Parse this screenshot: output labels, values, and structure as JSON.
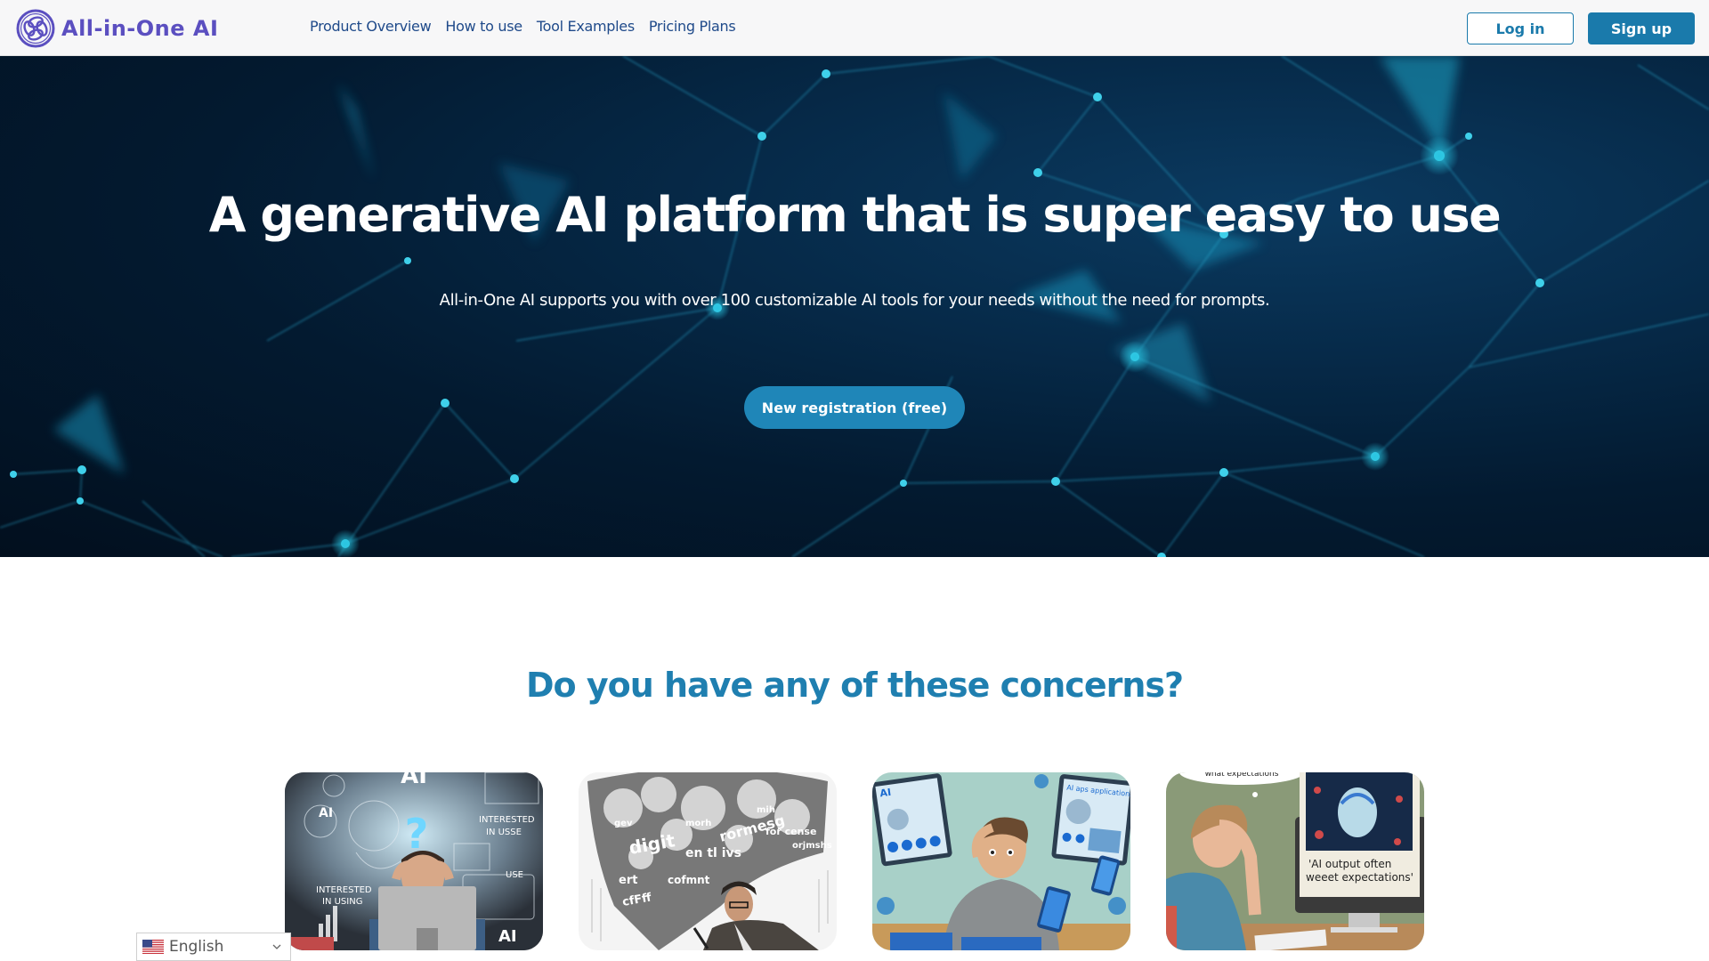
{
  "header": {
    "brand": "All-in-One AI",
    "nav": [
      {
        "label": "Product Overview"
      },
      {
        "label": "How to use"
      },
      {
        "label": "Tool Examples"
      },
      {
        "label": "Pricing Plans"
      }
    ],
    "login_label": "Log in",
    "signup_label": "Sign up"
  },
  "hero": {
    "title": "A generative AI platform that is super easy to use",
    "subtitle": "All-in-One AI supports you with over 100 customizable AI tools for your needs without the need for prompts.",
    "cta_label": "New registration (free)"
  },
  "concerns": {
    "title": "Do you have any of these concerns?",
    "cards": [
      {
        "image": "person-confused-by-ai-illustration",
        "captions": [
          "AI",
          "?",
          "INTERESTED IN USSE",
          "INTERESTED IN USING",
          "USE",
          "AI"
        ]
      },
      {
        "image": "person-overwhelmed-by-word-cloud-illustration",
        "captions": [
          "digit",
          "rormesg",
          "for cense"
        ]
      },
      {
        "image": "person-overwhelmed-by-many-ai-apps-illustration",
        "captions": [
          "AI apps",
          "AI aps applications",
          "AI"
        ]
      },
      {
        "image": "person-disappointed-by-ai-output-illustration",
        "captions": [
          "'AI output often",
          "weeet expectations'",
          "what expectations"
        ]
      }
    ]
  },
  "language": {
    "selected": "English",
    "flag": "us-flag-icon"
  },
  "colors": {
    "brand": "#5b4fc0",
    "nav_link": "#1f4a8a",
    "primary": "#1a7aab",
    "cta": "#1f86b8",
    "section_title": "#1f7fb0",
    "hero_bg": "#031a30"
  }
}
